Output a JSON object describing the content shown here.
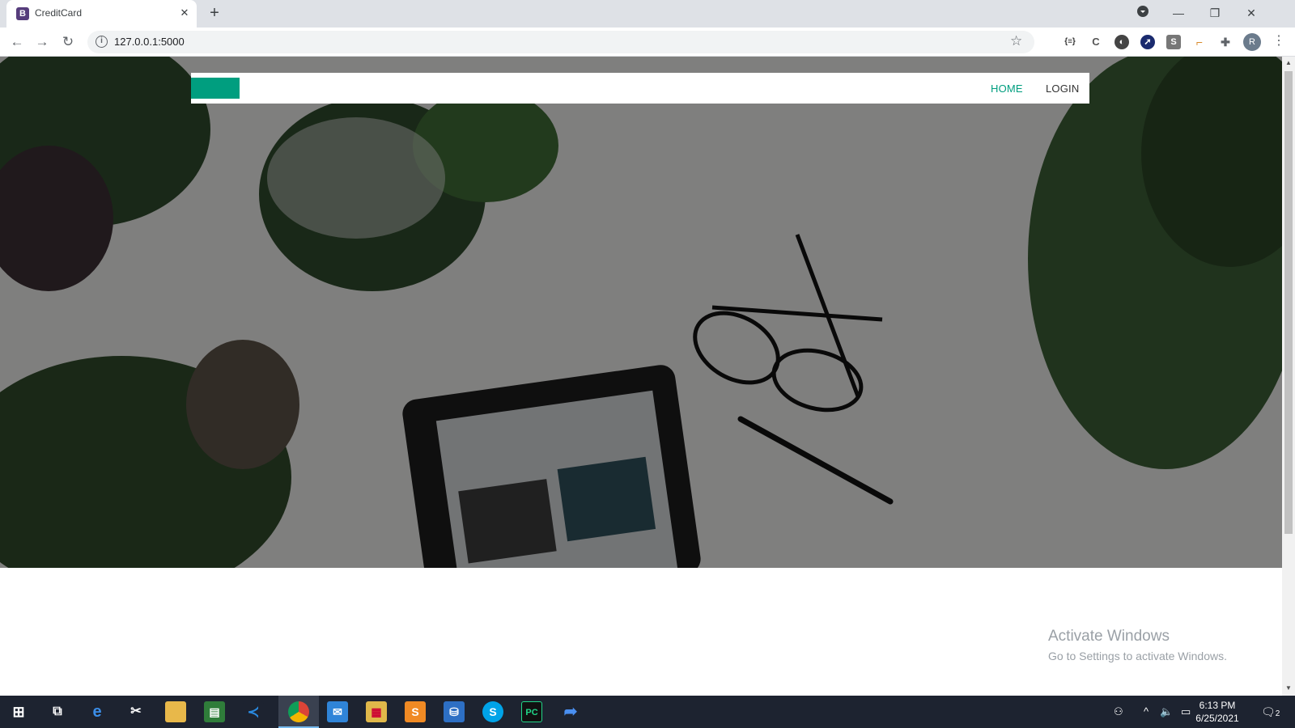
{
  "browser": {
    "tab_title": "CreditCard",
    "tab_favicon_letter": "B",
    "url": "127.0.0.1:5000",
    "profile_initial": "R"
  },
  "page": {
    "nav": {
      "home_label": "HOME",
      "login_label": "LOGIN"
    },
    "colors": {
      "accent": "#009e7f",
      "brand_block": "#009e7f"
    }
  },
  "watermark": {
    "line1": "Activate Windows",
    "line2": "Go to Settings to activate Windows."
  },
  "taskbar": {
    "time": "6:13 PM",
    "date": "6/25/2021",
    "notification_count": "2"
  }
}
